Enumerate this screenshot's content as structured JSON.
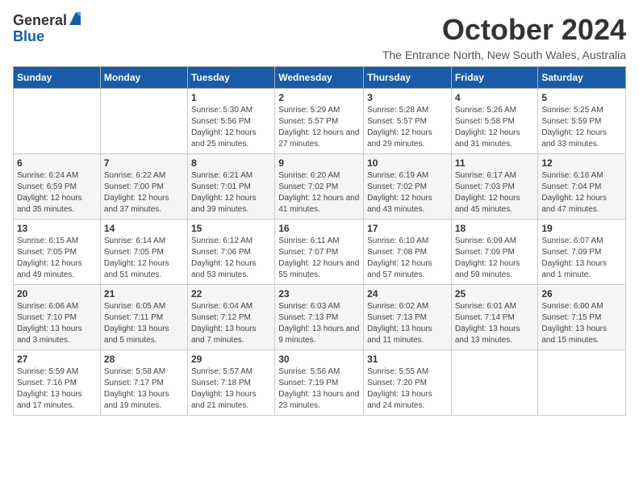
{
  "logo": {
    "general": "General",
    "blue": "Blue"
  },
  "title": "October 2024",
  "location": "The Entrance North, New South Wales, Australia",
  "days_of_week": [
    "Sunday",
    "Monday",
    "Tuesday",
    "Wednesday",
    "Thursday",
    "Friday",
    "Saturday"
  ],
  "weeks": [
    [
      {
        "day": "",
        "info": ""
      },
      {
        "day": "",
        "info": ""
      },
      {
        "day": "1",
        "info": "Sunrise: 5:30 AM\nSunset: 5:56 PM\nDaylight: 12 hours and 25 minutes."
      },
      {
        "day": "2",
        "info": "Sunrise: 5:29 AM\nSunset: 5:57 PM\nDaylight: 12 hours and 27 minutes."
      },
      {
        "day": "3",
        "info": "Sunrise: 5:28 AM\nSunset: 5:57 PM\nDaylight: 12 hours and 29 minutes."
      },
      {
        "day": "4",
        "info": "Sunrise: 5:26 AM\nSunset: 5:58 PM\nDaylight: 12 hours and 31 minutes."
      },
      {
        "day": "5",
        "info": "Sunrise: 5:25 AM\nSunset: 5:59 PM\nDaylight: 12 hours and 33 minutes."
      }
    ],
    [
      {
        "day": "6",
        "info": "Sunrise: 6:24 AM\nSunset: 6:59 PM\nDaylight: 12 hours and 35 minutes."
      },
      {
        "day": "7",
        "info": "Sunrise: 6:22 AM\nSunset: 7:00 PM\nDaylight: 12 hours and 37 minutes."
      },
      {
        "day": "8",
        "info": "Sunrise: 6:21 AM\nSunset: 7:01 PM\nDaylight: 12 hours and 39 minutes."
      },
      {
        "day": "9",
        "info": "Sunrise: 6:20 AM\nSunset: 7:02 PM\nDaylight: 12 hours and 41 minutes."
      },
      {
        "day": "10",
        "info": "Sunrise: 6:19 AM\nSunset: 7:02 PM\nDaylight: 12 hours and 43 minutes."
      },
      {
        "day": "11",
        "info": "Sunrise: 6:17 AM\nSunset: 7:03 PM\nDaylight: 12 hours and 45 minutes."
      },
      {
        "day": "12",
        "info": "Sunrise: 6:16 AM\nSunset: 7:04 PM\nDaylight: 12 hours and 47 minutes."
      }
    ],
    [
      {
        "day": "13",
        "info": "Sunrise: 6:15 AM\nSunset: 7:05 PM\nDaylight: 12 hours and 49 minutes."
      },
      {
        "day": "14",
        "info": "Sunrise: 6:14 AM\nSunset: 7:05 PM\nDaylight: 12 hours and 51 minutes."
      },
      {
        "day": "15",
        "info": "Sunrise: 6:12 AM\nSunset: 7:06 PM\nDaylight: 12 hours and 53 minutes."
      },
      {
        "day": "16",
        "info": "Sunrise: 6:11 AM\nSunset: 7:07 PM\nDaylight: 12 hours and 55 minutes."
      },
      {
        "day": "17",
        "info": "Sunrise: 6:10 AM\nSunset: 7:08 PM\nDaylight: 12 hours and 57 minutes."
      },
      {
        "day": "18",
        "info": "Sunrise: 6:09 AM\nSunset: 7:09 PM\nDaylight: 12 hours and 59 minutes."
      },
      {
        "day": "19",
        "info": "Sunrise: 6:07 AM\nSunset: 7:09 PM\nDaylight: 13 hours and 1 minute."
      }
    ],
    [
      {
        "day": "20",
        "info": "Sunrise: 6:06 AM\nSunset: 7:10 PM\nDaylight: 13 hours and 3 minutes."
      },
      {
        "day": "21",
        "info": "Sunrise: 6:05 AM\nSunset: 7:11 PM\nDaylight: 13 hours and 5 minutes."
      },
      {
        "day": "22",
        "info": "Sunrise: 6:04 AM\nSunset: 7:12 PM\nDaylight: 13 hours and 7 minutes."
      },
      {
        "day": "23",
        "info": "Sunrise: 6:03 AM\nSunset: 7:13 PM\nDaylight: 13 hours and 9 minutes."
      },
      {
        "day": "24",
        "info": "Sunrise: 6:02 AM\nSunset: 7:13 PM\nDaylight: 13 hours and 11 minutes."
      },
      {
        "day": "25",
        "info": "Sunrise: 6:01 AM\nSunset: 7:14 PM\nDaylight: 13 hours and 13 minutes."
      },
      {
        "day": "26",
        "info": "Sunrise: 6:00 AM\nSunset: 7:15 PM\nDaylight: 13 hours and 15 minutes."
      }
    ],
    [
      {
        "day": "27",
        "info": "Sunrise: 5:59 AM\nSunset: 7:16 PM\nDaylight: 13 hours and 17 minutes."
      },
      {
        "day": "28",
        "info": "Sunrise: 5:58 AM\nSunset: 7:17 PM\nDaylight: 13 hours and 19 minutes."
      },
      {
        "day": "29",
        "info": "Sunrise: 5:57 AM\nSunset: 7:18 PM\nDaylight: 13 hours and 21 minutes."
      },
      {
        "day": "30",
        "info": "Sunrise: 5:56 AM\nSunset: 7:19 PM\nDaylight: 13 hours and 23 minutes."
      },
      {
        "day": "31",
        "info": "Sunrise: 5:55 AM\nSunset: 7:20 PM\nDaylight: 13 hours and 24 minutes."
      },
      {
        "day": "",
        "info": ""
      },
      {
        "day": "",
        "info": ""
      }
    ]
  ]
}
